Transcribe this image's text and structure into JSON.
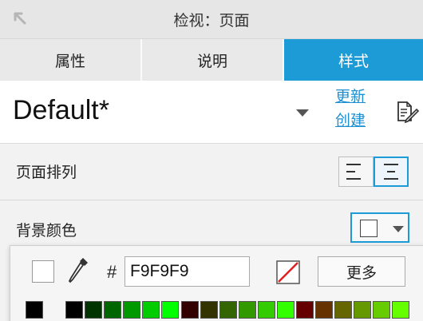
{
  "panel": {
    "title": "检视：页面"
  },
  "tabs": [
    {
      "label": "属性"
    },
    {
      "label": "说明"
    },
    {
      "label": "样式",
      "active": true
    }
  ],
  "style": {
    "name": "Default*",
    "update_link": "更新",
    "create_link": "创建"
  },
  "arrangement": {
    "label": "页面排列",
    "options": [
      "align-left",
      "align-center"
    ],
    "selected": "align-center"
  },
  "background": {
    "label": "背景颜色",
    "current_color": "#FFFFFF"
  },
  "picker": {
    "hash": "#",
    "hex_value": "F9F9F9",
    "more_label": "更多",
    "swatches": [
      "#000000",
      "#000000",
      "#003300",
      "#006600",
      "#009900",
      "#00CC00",
      "#00FF00",
      "#330000",
      "#333300",
      "#336600",
      "#339900",
      "#33CC00",
      "#33FF00",
      "#660000",
      "#663300",
      "#666600",
      "#669900",
      "#66CC00",
      "#66FF00"
    ]
  },
  "colors": {
    "accent": "#1D9BD7",
    "link": "#1D8FD0"
  }
}
